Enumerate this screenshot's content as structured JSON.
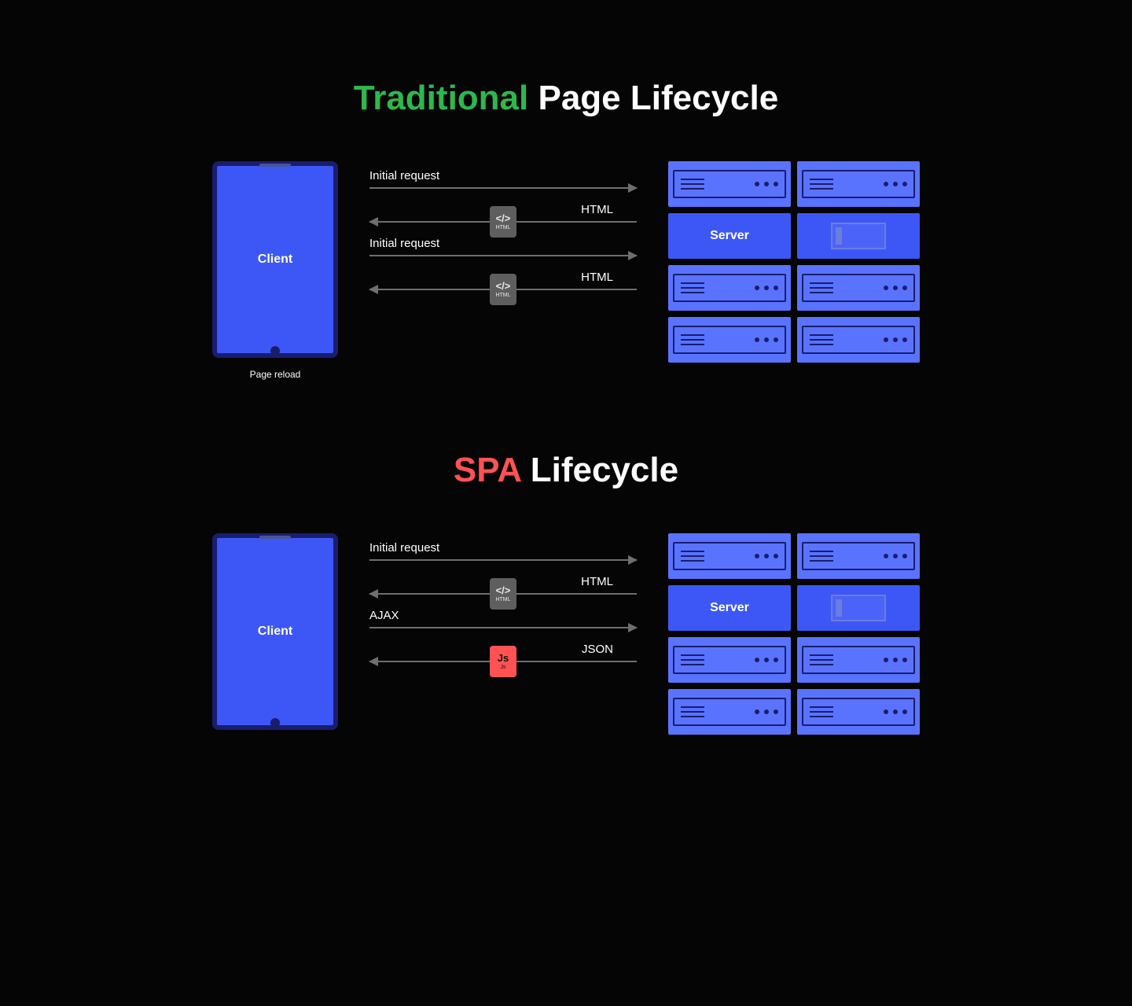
{
  "section1": {
    "title_accent": "Traditional",
    "title_rest": "Page Lifecycle",
    "client_label": "Client",
    "client_caption": "Page reload",
    "server_label": "Server",
    "arrows": [
      {
        "label": "Initial request",
        "dir": "right",
        "icon": null
      },
      {
        "label": "HTML",
        "dir": "left",
        "icon": "html",
        "icon_glyph": "</>",
        "icon_caption": "HTML"
      },
      {
        "label": "Initial request",
        "dir": "right",
        "icon": null
      },
      {
        "label": "HTML",
        "dir": "left",
        "icon": "html",
        "icon_glyph": "</>",
        "icon_caption": "HTML"
      }
    ]
  },
  "section2": {
    "title_accent": "SPA",
    "title_rest": "Lifecycle",
    "client_label": "Client",
    "server_label": "Server",
    "arrows": [
      {
        "label": "Initial request",
        "dir": "right",
        "icon": null
      },
      {
        "label": "HTML",
        "dir": "left",
        "icon": "html",
        "icon_glyph": "</>",
        "icon_caption": "HTML"
      },
      {
        "label": "AJAX",
        "dir": "right",
        "icon": null
      },
      {
        "label": "JSON",
        "dir": "left",
        "icon": "js",
        "icon_glyph": "Js",
        "icon_caption": "Js"
      }
    ]
  }
}
